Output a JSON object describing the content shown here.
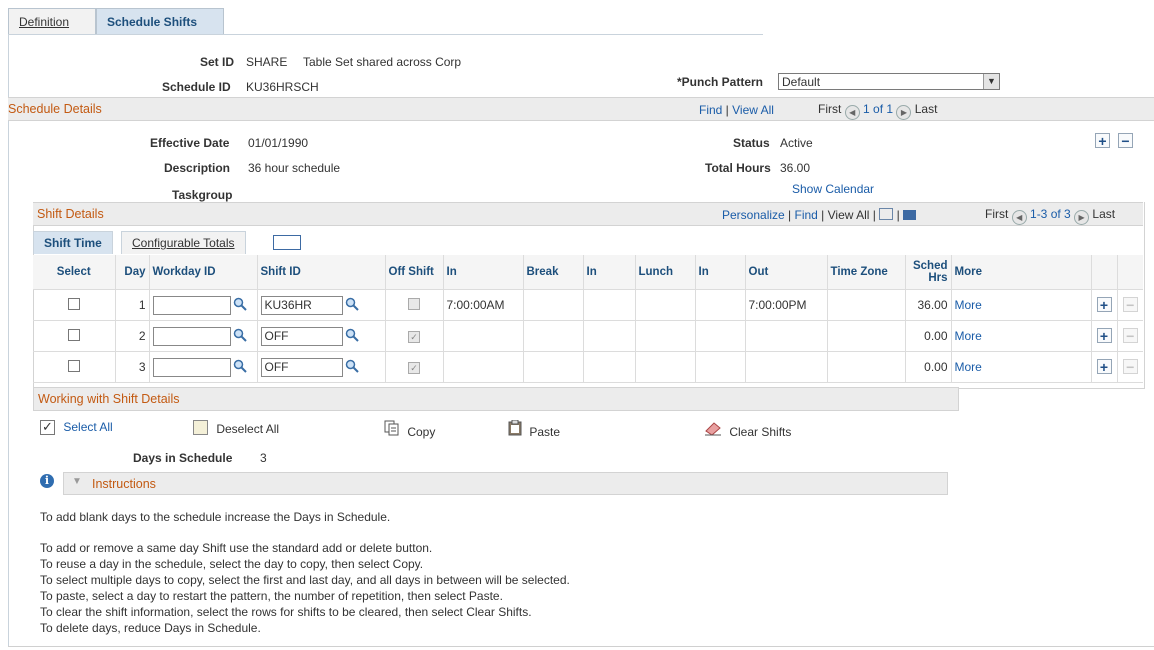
{
  "tabs": {
    "definition": "Definition",
    "schedule_shifts": "Schedule Shifts"
  },
  "header": {
    "setid_label": "Set ID",
    "setid_value": "SHARE",
    "setid_desc": "Table Set shared across Corp",
    "scheduleid_label": "Schedule ID",
    "scheduleid_value": "KU36HRSCH",
    "punch_label": "*Punch Pattern",
    "punch_value": "Default"
  },
  "schedule_details": {
    "title": "Schedule Details",
    "find": "Find",
    "view_all": "View All",
    "first": "First",
    "count": "1 of 1",
    "last": "Last",
    "effdt_label": "Effective Date",
    "effdt_value": "01/01/1990",
    "desc_label": "Description",
    "desc_value": "36 hour schedule",
    "taskgroup_label": "Taskgroup",
    "status_label": "Status",
    "status_value": "Active",
    "total_label": "Total Hours",
    "total_value": "36.00",
    "show_calendar": "Show Calendar"
  },
  "shift_details": {
    "title": "Shift Details",
    "personalize": "Personalize",
    "find": "Find",
    "view_all": "View All",
    "first": "First",
    "count": "1-3 of 3",
    "last": "Last",
    "tab_shift_time": "Shift Time",
    "tab_config_totals": "Configurable Totals",
    "columns": {
      "select": "Select",
      "day": "Day",
      "workday": "Workday ID",
      "shift": "Shift ID",
      "off": "Off Shift",
      "in1": "In",
      "break": "Break",
      "in2": "In",
      "lunch": "Lunch",
      "in3": "In",
      "out": "Out",
      "tz": "Time Zone",
      "sched1": "Sched",
      "sched2": "Hrs",
      "more": "More"
    },
    "rows": [
      {
        "day": "1",
        "workday": "",
        "shift": "KU36HR",
        "in": "7:00:00AM",
        "out": "7:00:00PM",
        "hrs": "36.00",
        "more": "More"
      },
      {
        "day": "2",
        "workday": "",
        "shift": "OFF",
        "in": "",
        "out": "",
        "hrs": "0.00",
        "more": "More"
      },
      {
        "day": "3",
        "workday": "",
        "shift": "OFF",
        "in": "",
        "out": "",
        "hrs": "0.00",
        "more": "More"
      }
    ]
  },
  "working": {
    "title": "Working with Shift Details",
    "select_all": "Select All",
    "deselect_all": "Deselect All",
    "copy": "Copy",
    "paste": "Paste",
    "clear": "Clear Shifts",
    "days_label": "Days in Schedule",
    "days_value": "3"
  },
  "instructions": {
    "title": "Instructions",
    "lines": [
      "To add blank days to the schedule increase the Days in Schedule.",
      "To add or remove a same day Shift use the standard add or delete button.",
      "To reuse a day in the schedule, select the day to copy, then select Copy.",
      "To select multiple days to copy, select the first and last day, and all days in between will be selected.",
      "To paste, select a day to restart the pattern, the number of repetition, then select Paste.",
      "To clear the shift information, select the rows for shifts to be cleared, then select Clear Shifts.",
      "To delete days, reduce Days in Schedule."
    ]
  }
}
